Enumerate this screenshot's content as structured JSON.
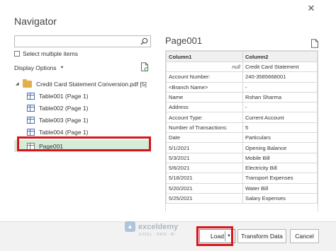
{
  "window": {
    "title": "Navigator",
    "close_glyph": "✕"
  },
  "left": {
    "search": {
      "value": "",
      "placeholder": ""
    },
    "select_multiple": "Select multiple items",
    "display_options": "Display Options",
    "tree": {
      "root": "Credit Card Statement Conversion.pdf [5]",
      "items": [
        {
          "label": "Table001 (Page 1)",
          "icon": "table-icon"
        },
        {
          "label": "Table002 (Page 1)",
          "icon": "table-icon"
        },
        {
          "label": "Table003 (Page 1)",
          "icon": "table-icon"
        },
        {
          "label": "Table004 (Page 1)",
          "icon": "table-icon"
        },
        {
          "label": "Page001",
          "icon": "page-icon",
          "selected": true
        }
      ]
    }
  },
  "preview": {
    "title": "Page001",
    "columns": [
      "Column1",
      "Column2"
    ],
    "rows": [
      [
        "null",
        "Credit Card Statement"
      ],
      [
        "Account Number:",
        "240-3585668001"
      ],
      [
        "<Branch Name>",
        "-"
      ],
      [
        "Name",
        "Rohan Sharma"
      ],
      [
        "Address",
        "-"
      ],
      [
        "Account Type:",
        "Current Account"
      ],
      [
        "Number of Transactions:",
        "5"
      ],
      [
        "Date",
        "Particulars"
      ],
      [
        "5/1/2021",
        "Opening Balance"
      ],
      [
        "5/3/2021",
        "Mobile Bill"
      ],
      [
        "5/6/2021",
        "Electricity Bill"
      ],
      [
        "5/18/2021",
        "Transport Expenses"
      ],
      [
        "5/20/2021",
        "Water Bill"
      ],
      [
        "5/25/2021",
        "Salary Expenses"
      ]
    ]
  },
  "footer": {
    "load": "Load",
    "transform": "Transform Data",
    "cancel": "Cancel",
    "watermark": "exceldemy",
    "watermark_sub": "EXCEL · DATA · BI",
    "highlight_color": "#d7161c",
    "selected_color": "#d5ecd7"
  }
}
